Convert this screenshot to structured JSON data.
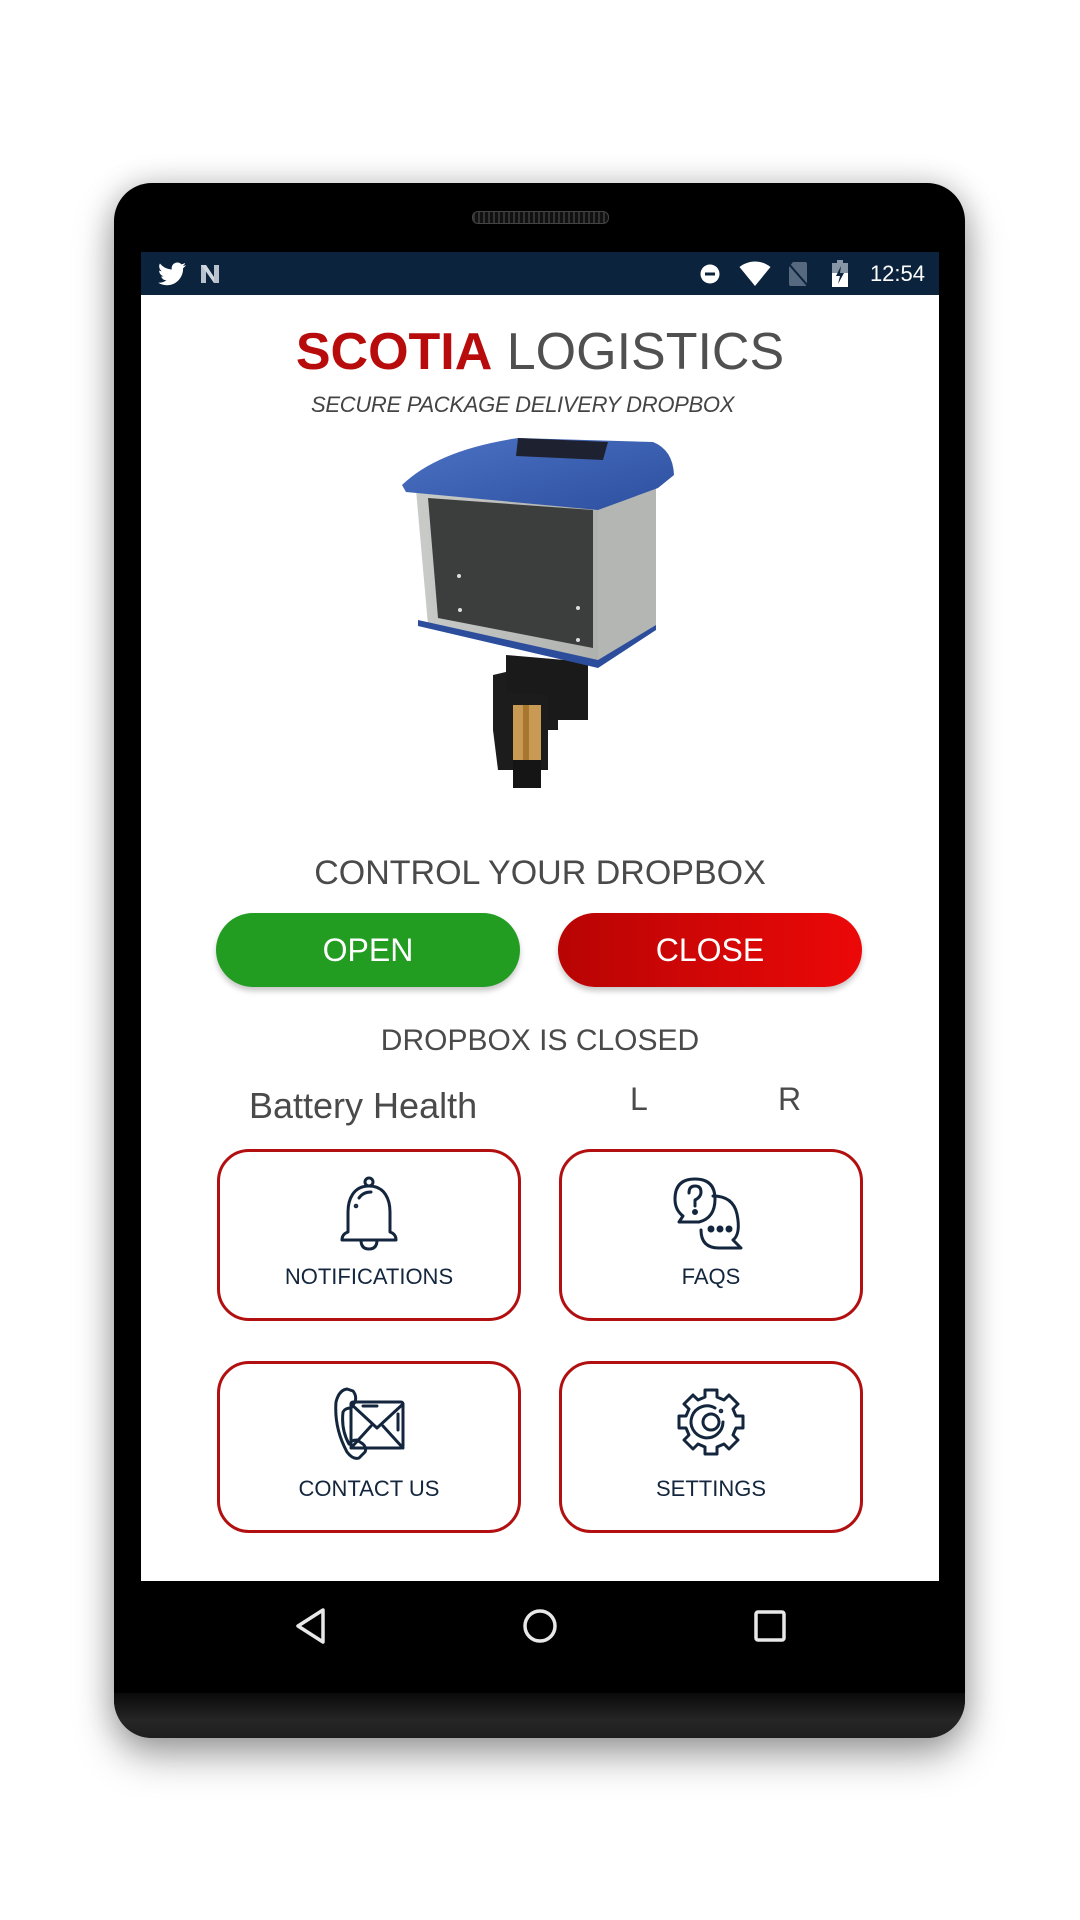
{
  "status_bar": {
    "time": "12:54",
    "left_icons": [
      "twitter-icon",
      "n-app-icon"
    ],
    "right_icons": [
      "do-not-disturb-icon",
      "wifi-icon",
      "no-sim-icon",
      "battery-charging-icon"
    ]
  },
  "header": {
    "brand_primary": "SCOTIA",
    "brand_secondary": "LOGISTICS",
    "subtitle": "SECURE PACKAGE DELIVERY DROPBOX"
  },
  "control": {
    "title": "CONTROL YOUR DROPBOX",
    "open_label": "OPEN",
    "close_label": "CLOSE",
    "status": "DROPBOX IS CLOSED"
  },
  "battery": {
    "label": "Battery Health",
    "left": "L",
    "right": "R"
  },
  "menu": [
    {
      "label": "NOTIFICATIONS",
      "icon": "bell-icon"
    },
    {
      "label": "FAQS",
      "icon": "faq-chat-icon"
    },
    {
      "label": "CONTACT US",
      "icon": "phone-mail-icon"
    },
    {
      "label": "SETTINGS",
      "icon": "gear-icon"
    }
  ],
  "navbar": [
    "back",
    "home",
    "recents"
  ],
  "colors": {
    "brand_red": "#b80c0c",
    "open_green": "#229d22",
    "close_red": "#e00808",
    "status_bar": "#0b233d",
    "card_border": "#b21010",
    "icon_navy": "#13263d"
  }
}
